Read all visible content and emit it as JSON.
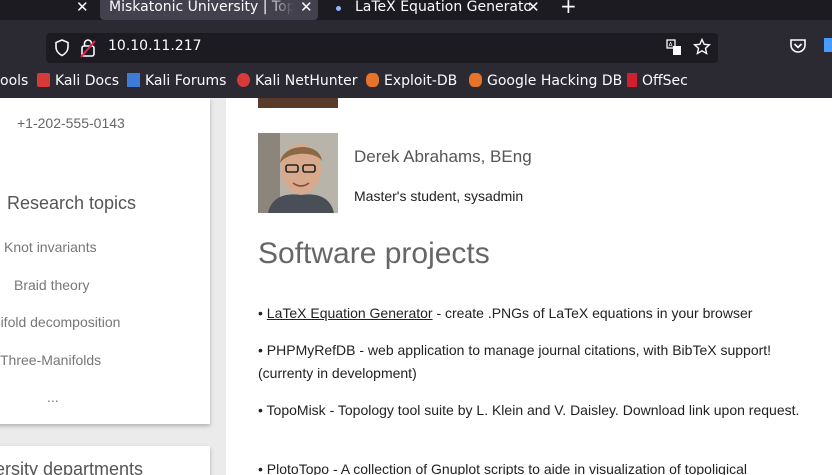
{
  "tabs": [
    {
      "title": "Miskatonic University | Topology"
    },
    {
      "title": "LaTeX Equation Generator"
    }
  ],
  "url": "10.10.11.217",
  "bookmarks": [
    "ools",
    "Kali Docs",
    "Kali Forums",
    "Kali NetHunter",
    "Exploit-DB",
    "Google Hacking DB",
    "OffSec"
  ],
  "sidebar": {
    "phone": "+1-202-555-0143",
    "topics_heading": "Research topics",
    "topics": [
      "Knot invariants",
      "Braid theory",
      "anifold decomposition",
      "Three-Manifolds",
      "..."
    ],
    "departments_heading": "ersity departments"
  },
  "person": {
    "name": "Derek Abrahams, BEng",
    "role": "Master's student, sysadmin"
  },
  "software": {
    "heading": "Software projects",
    "projects": [
      {
        "bullet": "•",
        "link": "LaTeX Equation Generator",
        "text": " - create .PNGs of LaTeX equations in your browser"
      },
      {
        "bullet": "•",
        "name": "PHPMyRefDB",
        "text": " - web application to manage journal citations, with BibTeX support! (currenty in development)"
      },
      {
        "bullet": "•",
        "name": "TopoMisk",
        "text": " - Topology tool suite by L. Klein and V. Daisley. Download link upon request."
      },
      {
        "bullet": "•",
        "name": "PlotoTopo",
        "text": " - A collection of Gnuplot scripts to aide in visualization of topoligical"
      }
    ]
  },
  "colors": {
    "chrome_dark": "#1c1b22",
    "chrome": "#2b2a33",
    "active_tab": "#42414d"
  }
}
